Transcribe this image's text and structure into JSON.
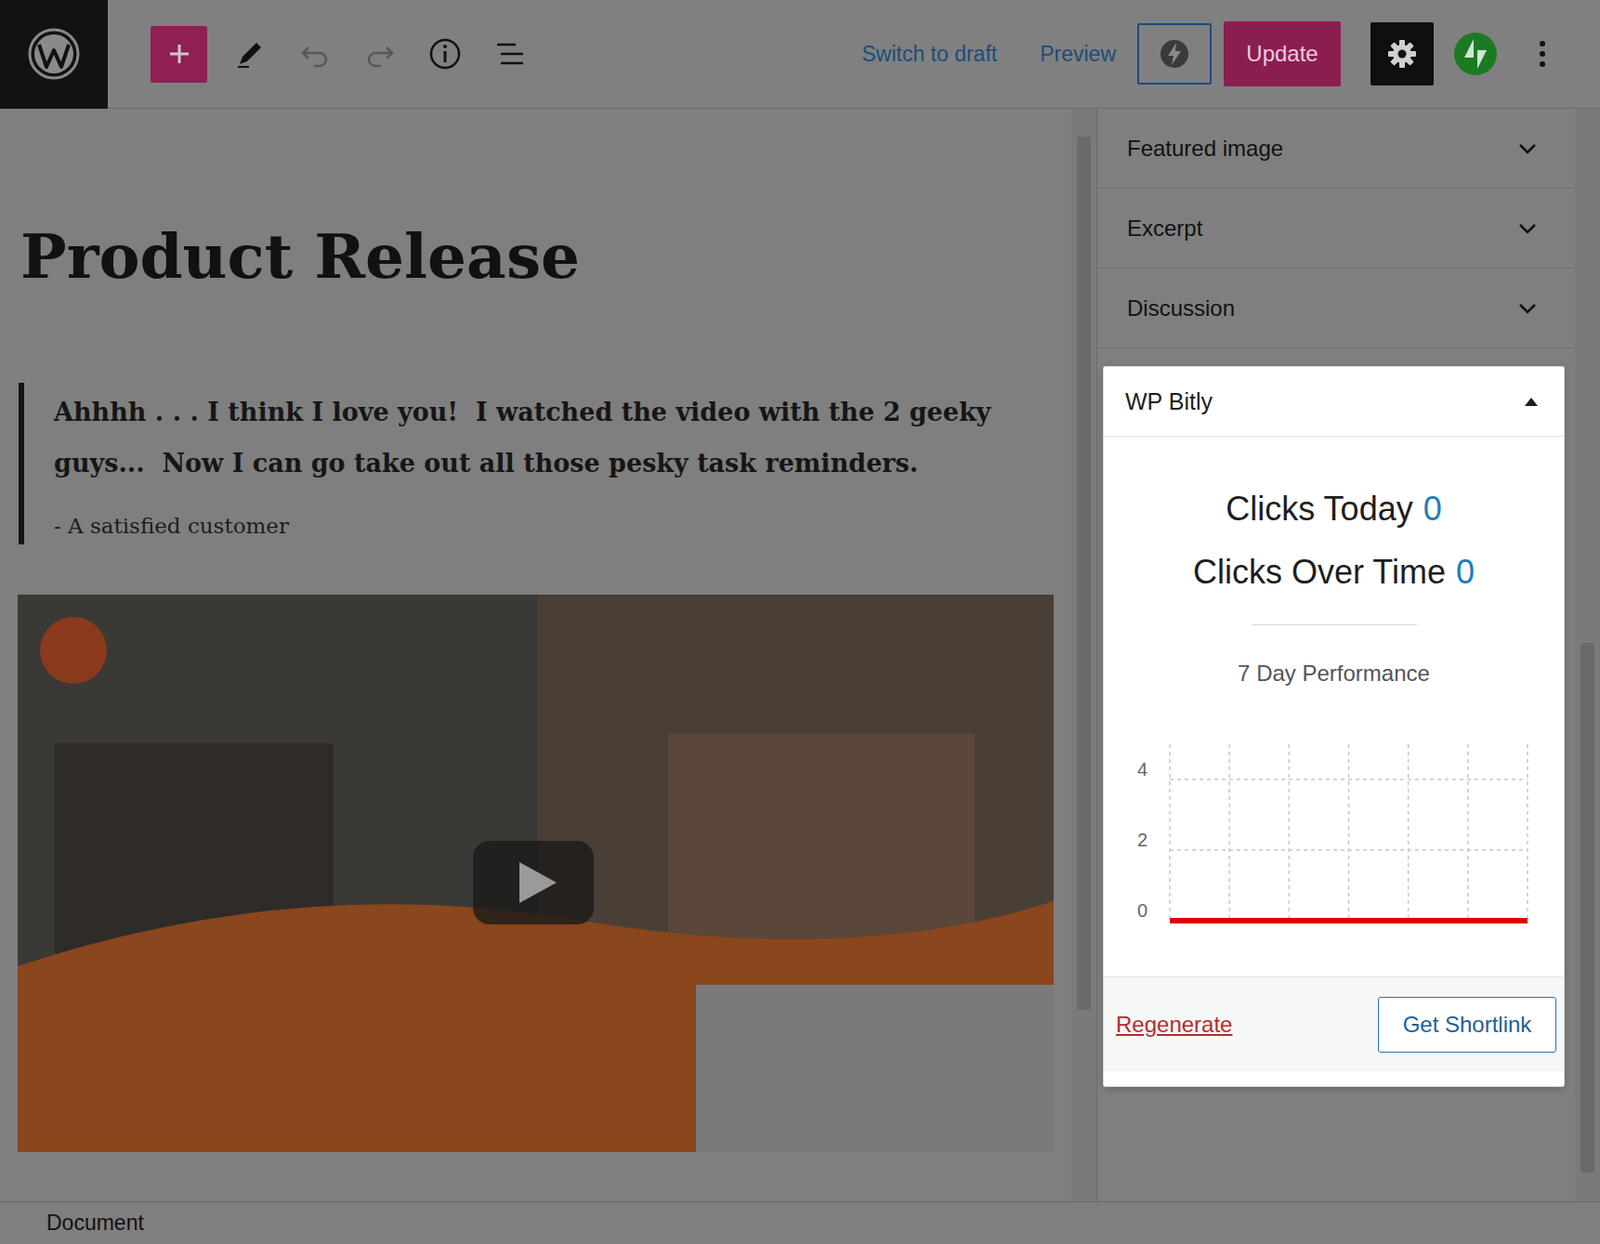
{
  "toolbar": {
    "undo": {
      "disabled": true
    },
    "redo": {
      "disabled": true
    },
    "switch_to_draft": "Switch to draft",
    "preview": "Preview",
    "update": "Update"
  },
  "post": {
    "title": "Product Release",
    "quote": "Ahhhh . . . I think I love you!  I watched the video with the 2 geeky guys...  Now I can go take out all those pesky task reminders.",
    "citation": "- A satisfied customer"
  },
  "sidebar": {
    "panels": [
      {
        "label": "Featured image",
        "expanded": false
      },
      {
        "label": "Excerpt",
        "expanded": false
      },
      {
        "label": "Discussion",
        "expanded": false
      }
    ]
  },
  "bitly": {
    "title": "WP Bitly",
    "expanded": true,
    "stats": [
      {
        "label": "Clicks Today",
        "value": "0"
      },
      {
        "label": "Clicks Over Time",
        "value": "0"
      }
    ],
    "chart": {
      "title": "7 Day Performance",
      "ticks": [
        "4",
        "2",
        "0"
      ],
      "series": [
        {
          "values": [
            0,
            0,
            0,
            0,
            0,
            0,
            0
          ],
          "color": "#e00000"
        }
      ]
    },
    "regenerate": "Regenerate",
    "get_shortlink": "Get Shortlink"
  },
  "status_bar": "Document"
}
